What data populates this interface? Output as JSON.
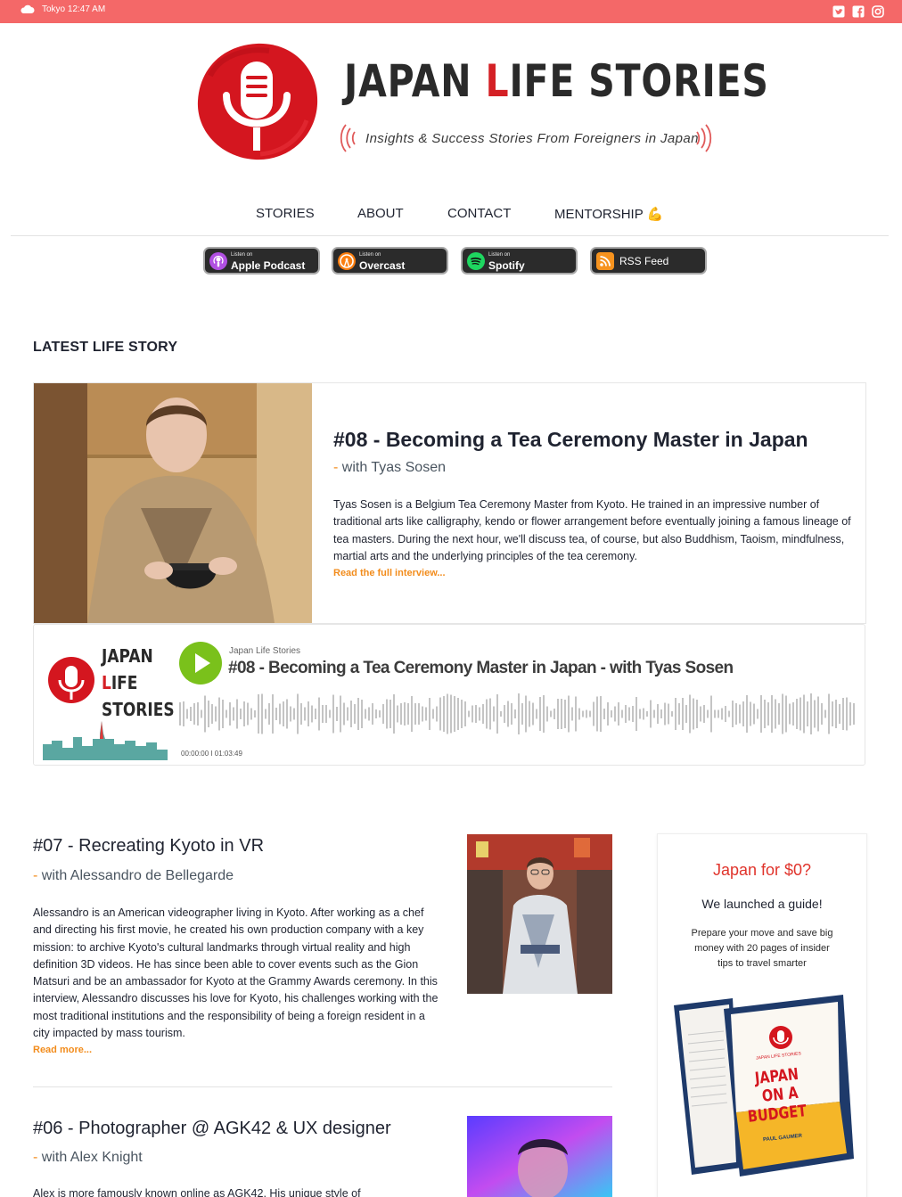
{
  "topbar": {
    "weather_text": "Tokyo 12:47 AM",
    "weather_icon": "cloud-icon",
    "social_icons": [
      "twitter-icon",
      "facebook-icon",
      "instagram-icon"
    ],
    "color": "#f46868"
  },
  "brand": {
    "title_part1": "Japan ",
    "title_l": "L",
    "title_part2": "ife Stories",
    "tagline": "Insights & Success Stories From Foreigners in Japan",
    "accent": "#d42025"
  },
  "nav": {
    "items": [
      {
        "label": "STORIES"
      },
      {
        "label": "ABOUT"
      },
      {
        "label": "CONTACT"
      },
      {
        "label": "MENTORSHIP 💪"
      }
    ]
  },
  "listen_buttons": [
    {
      "small": "Listen on",
      "label": "Apple Podcast",
      "icon": "apple-podcast-icon"
    },
    {
      "small": "Listen on",
      "label": "Overcast",
      "icon": "overcast-icon"
    },
    {
      "small": "Listen on",
      "label": "Spotify",
      "icon": "spotify-icon"
    },
    {
      "small": "",
      "label": "RSS Feed",
      "icon": "rss-icon"
    }
  ],
  "latest": {
    "section_title": "LATEST LIFE STORY",
    "title": "#08 - Becoming a Tea Ceremony Master in Japan",
    "guest_dash": "- ",
    "guest": "with Tyas Sosen",
    "description": "Tyas Sosen is a Belgium Tea Ceremony Master from Kyoto. He trained in an impressive number of traditional arts like calligraphy, kendo or flower arrangement before eventually joining a famous lineage of tea masters. During the next hour, we'll discuss tea, of course, but also Buddhism, Taoism, mindfulness, martial arts and the underlying principles of the tea ceremony.",
    "read_more": "Read the full interview..."
  },
  "player": {
    "cover_line1": "JAPAN",
    "cover_line2_l": "L",
    "cover_line2": "IFE",
    "cover_line3": "STORIES",
    "show": "Japan Life Stories",
    "title": "#08 - Becoming a Tea Ceremony Master in Japan - with Tyas Sosen",
    "time": "00:00:00  I  01:03:49",
    "play_color": "#7ac11b"
  },
  "episodes": [
    {
      "title": "#07 - Recreating Kyoto in VR",
      "guest_dash": "- ",
      "guest": "with Alessandro de Bellegarde",
      "description": "Alessandro is an American videographer living in Kyoto. After working as a chef and directing his first movie, he created his own production company with a key mission: to archive Kyoto's cultural landmarks through virtual reality and high definition 3D videos. He has since been able to cover events such as the Gion Matsuri and be an ambassador for Kyoto at the Grammy Awards ceremony. In this interview, Alessandro discusses his love for Kyoto, his challenges working with the most traditional institutions and the responsibility of being a foreign resident in a city impacted by mass tourism.",
      "read_more": "Read more..."
    },
    {
      "title": "#06 - Photographer @ AGK42 & UX designer",
      "guest_dash": "- ",
      "guest": "with Alex Knight",
      "description": "Alex is more famously known online as AGK42. His unique style of"
    }
  ],
  "sidebar": {
    "title": "Japan for $0?",
    "subtitle": "We launched a guide!",
    "text": "Prepare your move and save big money with 20 pages of insider tips to travel smarter",
    "book_brand": "JAPAN LIFE STORIES",
    "book_title_1": "JAPAN",
    "book_title_2": "ON A",
    "book_title_3": "BUDGET",
    "book_author": "PAUL GAUMER"
  }
}
